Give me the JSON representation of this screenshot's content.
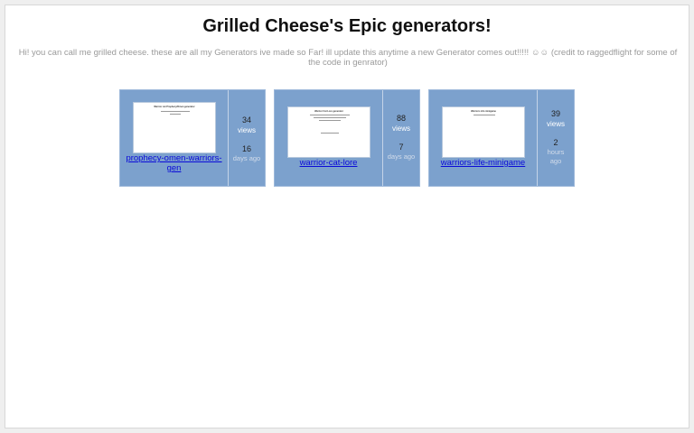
{
  "page": {
    "title": "Grilled Cheese's Epic generators!",
    "description": "Hi! you can call me grilled cheese. these are all my Generators ive made so Far! ill update this anytime a new Generator comes out!!!!! ☺☺ (credit to raggedflight for some of the code in genrator)"
  },
  "colors": {
    "card_bg": "#7ca1cd",
    "link": "#0a0ad8"
  },
  "cards": [
    {
      "name": "prophecy-omen-warriors-gen",
      "thumb_title": "Warrior cat Prophecy/Omen generator",
      "views_count": "34",
      "views_label": "views",
      "age_number": "16",
      "age_unit": "days ago"
    },
    {
      "name": "warrior-cat-lore",
      "thumb_title": "Warrior Cat Lore generator",
      "views_count": "88",
      "views_label": "views",
      "age_number": "7",
      "age_unit": "days ago"
    },
    {
      "name": "warriors-life-minigame",
      "thumb_title": "Warriors Life minigame",
      "views_count": "39",
      "views_label": "views",
      "age_number": "2",
      "age_unit": "hours ago"
    }
  ]
}
